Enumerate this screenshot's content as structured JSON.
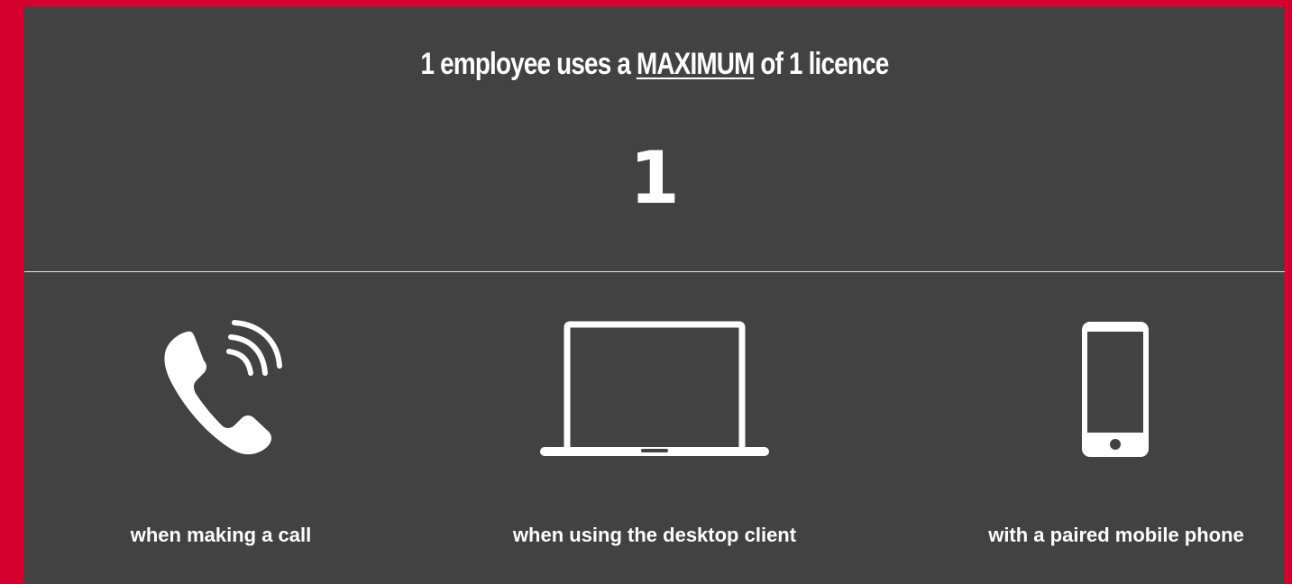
{
  "headline": {
    "prefix": "1 employee uses a ",
    "emphasis": "MAXIMUM",
    "suffix": " of 1 licence"
  },
  "big_number": "1",
  "features": [
    {
      "icon": "phone-call-icon",
      "label": "when making a call"
    },
    {
      "icon": "laptop-icon",
      "label": "when using the desktop client"
    },
    {
      "icon": "smartphone-icon",
      "label": "with a paired mobile phone"
    }
  ],
  "colors": {
    "frame": "#d6002f",
    "panel": "#424242",
    "text": "#ffffff"
  }
}
